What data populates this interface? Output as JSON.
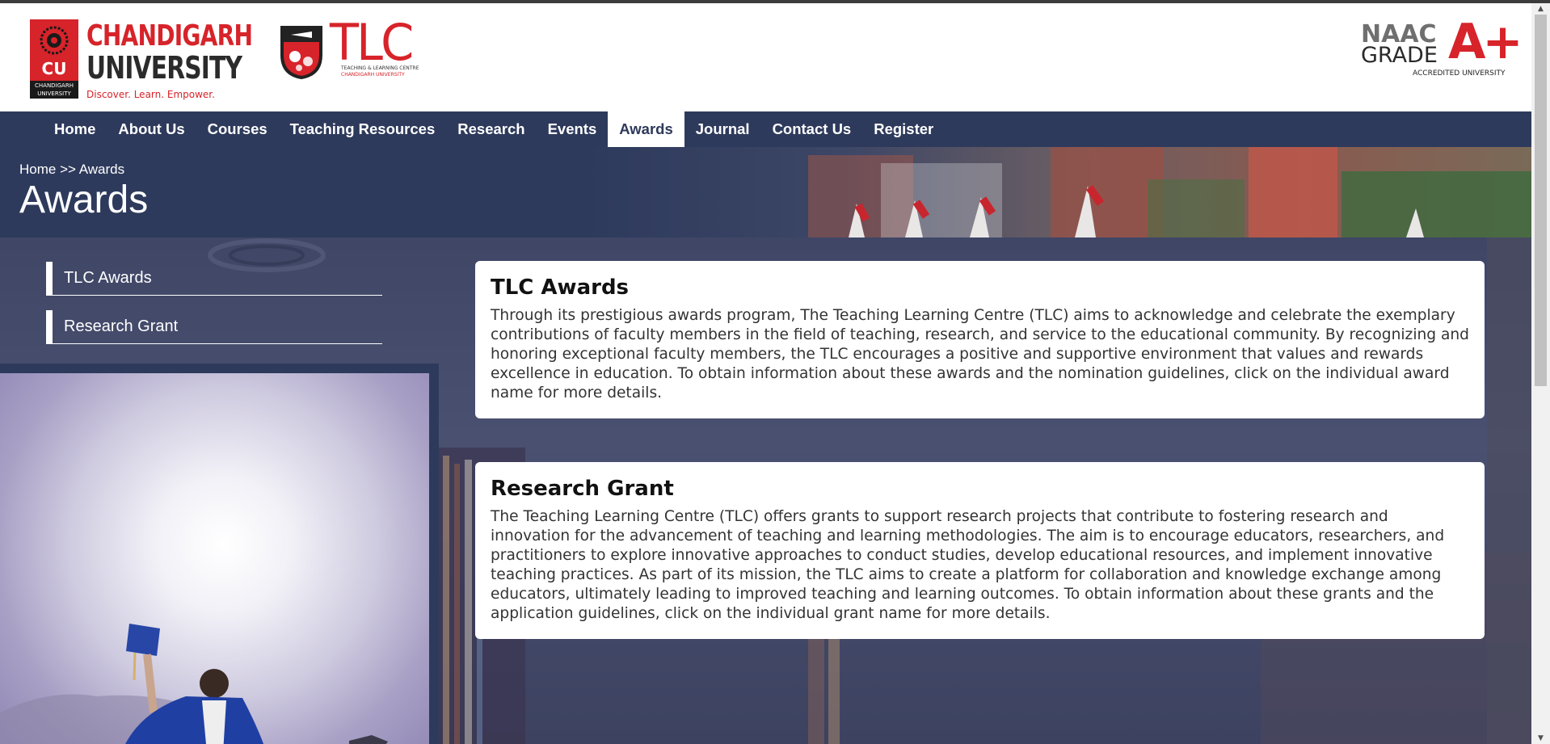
{
  "header": {
    "cu_logo": {
      "badge": "CU",
      "small": "CHANDIGARH UNIVERSITY",
      "name_line1": "CHANDIGARH",
      "name_line2": "UNIVERSITY",
      "tagline": "Discover. Learn. Empower."
    },
    "tlc_logo": {
      "word": "TLC",
      "sub1": "TEACHING & LEARNING CENTRE",
      "sub2": "CHANDIGARH UNIVERSITY"
    },
    "naac": {
      "line1": "NAAC",
      "line2": "GRADE",
      "grade": "A+",
      "accredited": "ACCREDITED UNIVERSITY"
    }
  },
  "nav": {
    "items": [
      {
        "label": "Home",
        "active": false
      },
      {
        "label": "About Us",
        "active": false
      },
      {
        "label": "Courses",
        "active": false
      },
      {
        "label": "Teaching Resources",
        "active": false
      },
      {
        "label": "Research",
        "active": false
      },
      {
        "label": "Events",
        "active": false
      },
      {
        "label": "Awards",
        "active": true
      },
      {
        "label": "Journal",
        "active": false
      },
      {
        "label": "Contact Us",
        "active": false
      },
      {
        "label": "Register",
        "active": false
      }
    ]
  },
  "banner": {
    "breadcrumb": "Home >> Awards",
    "title": "Awards"
  },
  "sidebar": {
    "items": [
      {
        "label": "TLC Awards"
      },
      {
        "label": "Research Grant"
      }
    ]
  },
  "cards": [
    {
      "title": "TLC Awards",
      "body": "Through its prestigious awards program, The Teaching Learning Centre (TLC) aims to acknowledge and celebrate the exemplary contributions of faculty members in the field of teaching, research, and service to the educational community. By recognizing and honoring exceptional faculty members, the TLC encourages a positive and supportive environment that values and rewards excellence in education. To obtain information about these awards and the nomination guidelines, click on the individual award name for more details."
    },
    {
      "title": "Research Grant",
      "body": "The Teaching Learning Centre (TLC) offers grants to support research projects that contribute to fostering research and innovation for the advancement of teaching and learning methodologies. The aim is to encourage educators, researchers, and practitioners to explore innovative approaches to conduct studies, develop educational resources, and implement innovative teaching practices. As part of its mission, the TLC aims to create a platform for collaboration and knowledge exchange among educators, ultimately leading to improved teaching and learning outcomes. To obtain information about these grants and the application guidelines, click on the individual grant name for more details."
    }
  ],
  "colors": {
    "navy": "#2e3a5c",
    "brand_red": "#d7232a",
    "white": "#ffffff"
  },
  "icons": {
    "scroll_up": "scroll-up-icon",
    "scroll_down": "scroll-down-icon"
  }
}
